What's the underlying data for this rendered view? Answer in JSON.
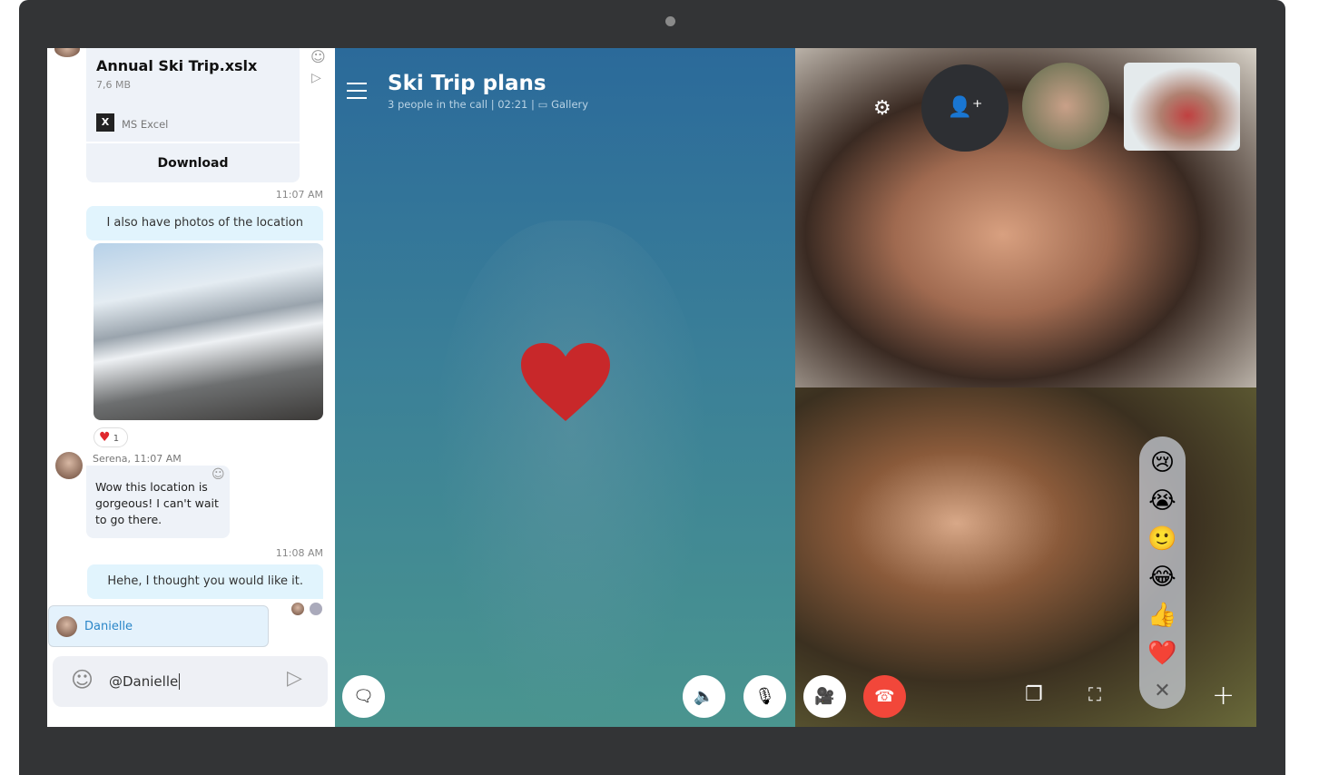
{
  "chat": {
    "file": {
      "name": "Annual Ski Trip.xslx",
      "size": "7,6 MB",
      "app": "MS Excel",
      "download": "Download"
    },
    "messages": [
      {
        "time": "11:07 AM",
        "text": "I also have photos of the location"
      },
      {
        "reaction_count": "1"
      },
      {
        "sender": "Serena, 11:07 AM",
        "text": "Wow this location is gorgeous! I can't wait to go there."
      },
      {
        "time": "11:08 AM",
        "text": "Hehe, I thought you would like it."
      }
    ],
    "mention_suggestion": "Danielle",
    "compose_value": "@Danielle"
  },
  "call": {
    "title": "Ski Trip plans",
    "subtitle": "3 people in the call | 02:21 |",
    "view": "Gallery"
  },
  "reactions": [
    "😢",
    "😭",
    "🙂",
    "😂",
    "👍",
    "❤️"
  ],
  "colors": {
    "accent": "#0078d4",
    "hangup": "#f2473a",
    "heart": "#e0282e"
  }
}
